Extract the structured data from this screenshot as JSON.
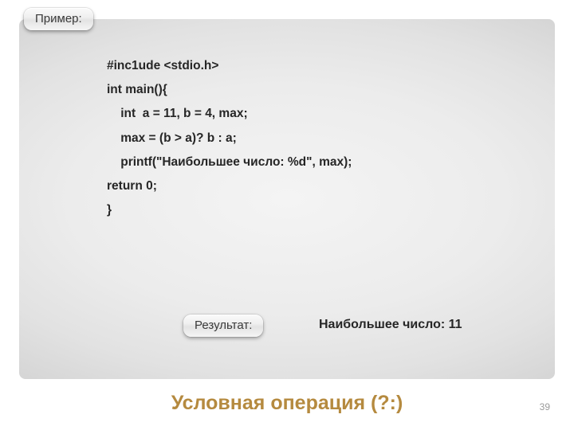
{
  "labels": {
    "example": "Пример:",
    "result": "Результат:"
  },
  "code": {
    "l1": "#inc1ude <stdio.h>",
    "l2": "int main(){",
    "l3": "    int  a = 11, b = 4, max;",
    "l4": "    max = (b > a)? b : a;",
    "l5": "    printf(\"Наибольшее число: %d\", max);",
    "l6": "return 0;",
    "l7": "}"
  },
  "output": "Наибольшее число: 11",
  "title": "Условная операция (?:)",
  "page": "39"
}
